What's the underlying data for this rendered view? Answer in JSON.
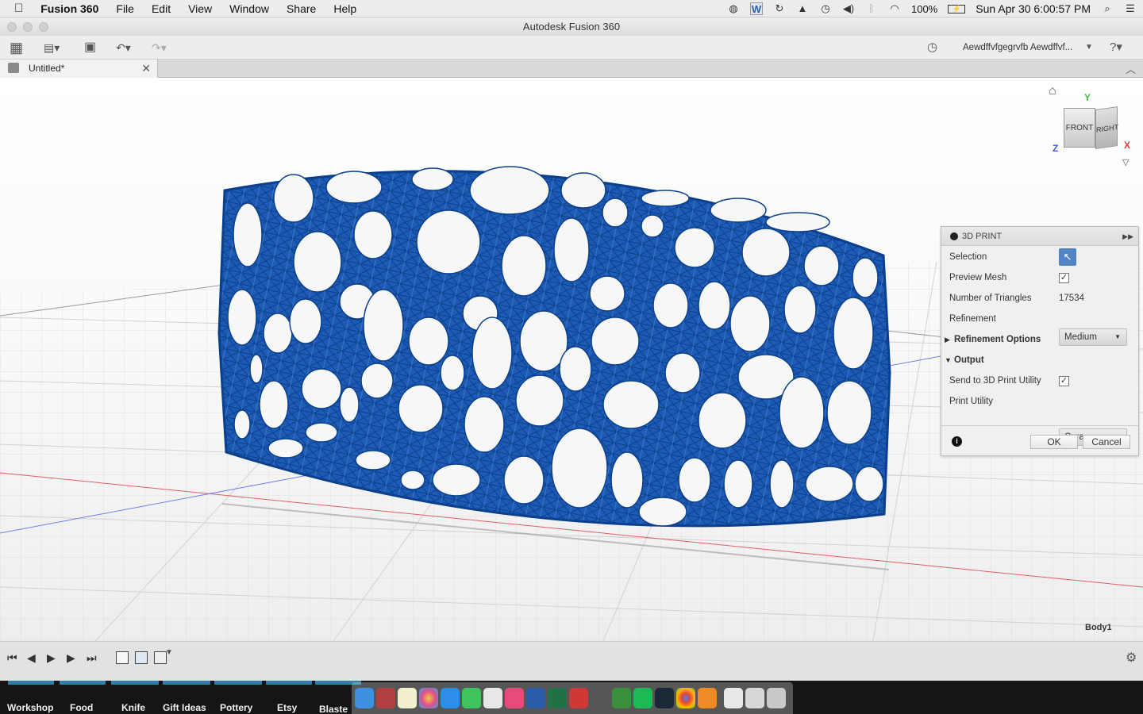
{
  "menubar": {
    "apple": "",
    "app_name": "Fusion 360",
    "menus": [
      "File",
      "Edit",
      "View",
      "Window",
      "Share",
      "Help"
    ],
    "battery": "100%",
    "datetime": "Sun Apr 30  6:00:57 PM"
  },
  "window": {
    "title": "Autodesk Fusion 360"
  },
  "toolbar": {
    "user": "Aewdffvfgegrvfb Aewdffvf..."
  },
  "tab": {
    "name": "Untitled*"
  },
  "viewcube": {
    "front": "FRONT",
    "right": "RIGHT",
    "axis_y": "Y",
    "axis_x": "X",
    "axis_z": "Z"
  },
  "body_label": "Body1",
  "panel": {
    "title": "3D PRINT",
    "selection_label": "Selection",
    "preview_mesh_label": "Preview Mesh",
    "preview_mesh_checked": "✓",
    "triangles_label": "Number of Triangles",
    "triangles_value": "17534",
    "refinement_label": "Refinement",
    "refinement_value": "Medium",
    "refinement_options_label": "Refinement Options",
    "output_label": "Output",
    "send_label": "Send to 3D Print Utility",
    "send_checked": "✓",
    "utility_label": "Print Utility",
    "utility_value": "Cura",
    "ok": "OK",
    "cancel": "Cancel"
  },
  "bottom_tabs": [
    "Workshop",
    "Food",
    "Knife",
    "Gift Ideas",
    "Pottery",
    "Etsy",
    "Blaste"
  ],
  "colors": {
    "mesh": "#0a4aa0",
    "mesh_light": "#3b78cc",
    "accent": "#3f74b6"
  }
}
